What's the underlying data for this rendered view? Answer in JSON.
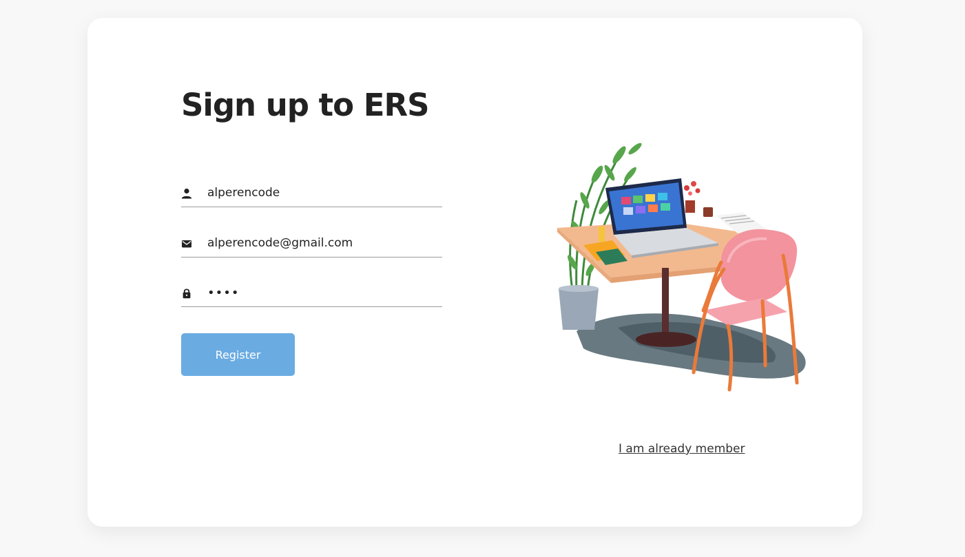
{
  "form": {
    "title": "Sign up to ERS",
    "username": {
      "value": "alperencode",
      "icon": "person-icon"
    },
    "email": {
      "value": "alperencode@gmail.com",
      "icon": "mail-icon"
    },
    "password": {
      "value": "••••",
      "icon": "lock-icon"
    },
    "register_label": "Register"
  },
  "aside": {
    "illustration": "desk-laptop-chair-plant-illustration",
    "member_link": "I am already member"
  },
  "colors": {
    "background": "#f8f8f8",
    "card": "#ffffff",
    "button": "#6aabe2",
    "text": "#222222"
  }
}
